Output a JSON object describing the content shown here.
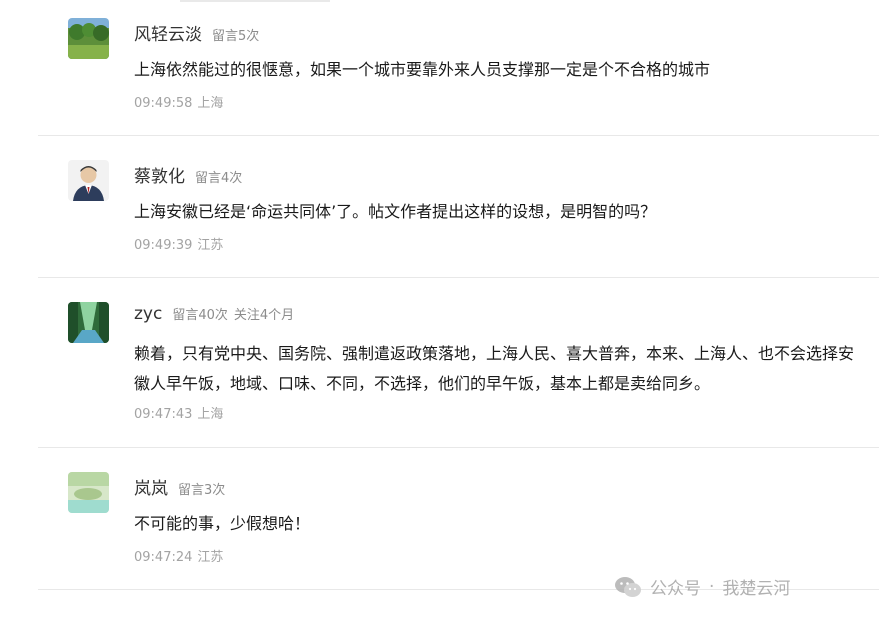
{
  "comments": [
    {
      "nickname": "风轻云淡",
      "badges": [
        "留言5次"
      ],
      "text": "上海依然能过的很惬意，如果一个城市要靠外来人员支撑那一定是个不合格的城市",
      "time": "09:49:58",
      "location": "上海",
      "avatar_icon": "landscape-avatar-icon"
    },
    {
      "nickname": "蔡敦化",
      "badges": [
        "留言4次"
      ],
      "text": "上海安徽已经是‘命运共同体’了。帖文作者提出这样的设想，是明智的吗？",
      "time": "09:49:39",
      "location": "江苏",
      "avatar_icon": "portrait-avatar-icon"
    },
    {
      "nickname": "zyc",
      "badges": [
        "留言40次",
        "关注4个月"
      ],
      "text": "赖着，只有党中央、国务院、强制遣返政策落地，上海人民、喜大普奔，本来、上海人、也不会选择安徽人早午饭，地域、口味、不同，不选择，他们的早午饭，基本上都是卖给同乡。",
      "time": "09:47:43",
      "location": "上海",
      "avatar_icon": "forest-avatar-icon"
    },
    {
      "nickname": "岚岚",
      "badges": [
        "留言3次"
      ],
      "text": "不可能的事，少假想哈！",
      "time": "09:47:24",
      "location": "江苏",
      "avatar_icon": "mist-avatar-icon"
    }
  ],
  "watermark": {
    "account_type": "公众号",
    "separator": "·",
    "account_name": "我楚云河",
    "icon": "wechat-icon"
  },
  "colors": {
    "nickname": "#333333",
    "body_text": "#1a1a1a",
    "meta": "#a3a3a3",
    "divider": "#e8e8e8"
  }
}
